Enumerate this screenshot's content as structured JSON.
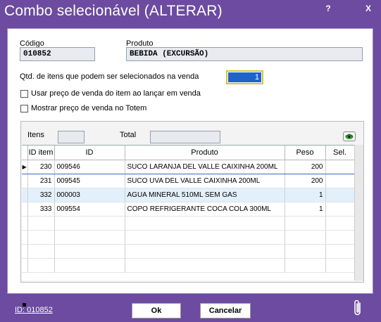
{
  "window": {
    "title": "Combo selecionável (ALTERAR)",
    "help_label": "?",
    "close_label": "X"
  },
  "codigo": {
    "label": "Código",
    "value": "010852"
  },
  "produto": {
    "label": "Produto",
    "value": "BEBIDA (EXCURSÃO)"
  },
  "qtd": {
    "label": "Qtd. de itens que podem ser selecionados na venda",
    "value": "1"
  },
  "options": [
    {
      "label": "Usar preço de venda do item ao lançar em venda",
      "checked": false
    },
    {
      "label": "Mostrar preço de venda no Totem",
      "checked": false
    }
  ],
  "grid": {
    "itens_label": "Itens",
    "itens_value": "",
    "total_label": "Total",
    "total_value": "",
    "refresh_icon": "refresh-icon",
    "columns": [
      "ID item",
      "ID",
      "Produto",
      "Peso",
      "Sel."
    ],
    "rows": [
      {
        "id_item": "230",
        "id": "009546",
        "produto": "SUCO LARANJA DEL VALLE CAIXINHA 200ML",
        "peso": "200",
        "sel": ""
      },
      {
        "id_item": "231",
        "id": "009545",
        "produto": "SUCO UVA DEL VALLE CAIXINHA 200ML",
        "peso": "200",
        "sel": ""
      },
      {
        "id_item": "332",
        "id": "000003",
        "produto": "AGUA MINERAL 510ML SEM GAS",
        "peso": "1",
        "sel": ""
      },
      {
        "id_item": "333",
        "id": "009554",
        "produto": "COPO REFRIGERANTE COCA COLA 300ML",
        "peso": "1",
        "sel": ""
      }
    ]
  },
  "footer": {
    "id_link": "ID: 010852",
    "ok_label": "Ok",
    "cancel_label": "Cancelar",
    "attach_icon": "paperclip-icon"
  },
  "colors": {
    "frame": "#6c4ba0",
    "selection": "#1f63c8",
    "alt_row": "#e2f0fb"
  }
}
